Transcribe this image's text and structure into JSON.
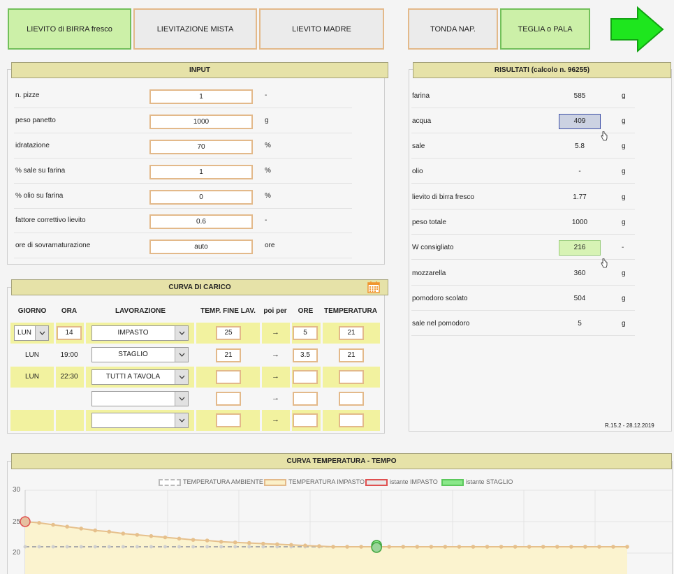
{
  "top_buttons": [
    {
      "label": "LIEVITO di BIRRA fresco"
    },
    {
      "label": "LIEVITAZIONE MISTA"
    },
    {
      "label": "LIEVITO MADRE"
    },
    {
      "label": "TONDA NAP."
    },
    {
      "label": "TEGLIA o PALA"
    }
  ],
  "input": {
    "title": "INPUT",
    "rows": [
      {
        "label": "n. pizze",
        "value": "1",
        "unit": "-"
      },
      {
        "label": "peso panetto",
        "value": "1000",
        "unit": "g"
      },
      {
        "label": "idratazione",
        "value": "70",
        "unit": "%"
      },
      {
        "label": "% sale su farina",
        "value": "1",
        "unit": "%"
      },
      {
        "label": "% olio su farina",
        "value": "0",
        "unit": "%"
      },
      {
        "label": "fattore correttivo lievito",
        "value": "0.6",
        "unit": "-"
      },
      {
        "label": "ore di sovramaturazione",
        "value": "auto",
        "unit": "ore"
      }
    ]
  },
  "results": {
    "title": "RISULTATI (calcolo n. 96255)",
    "rows": [
      {
        "label": "farina",
        "value": "585",
        "unit": "g"
      },
      {
        "label": "acqua",
        "value": "409",
        "unit": "g"
      },
      {
        "label": "sale",
        "value": "5.8",
        "unit": "g"
      },
      {
        "label": "olio",
        "value": "-",
        "unit": "g"
      },
      {
        "label": "lievito di birra fresco",
        "value": "1.77",
        "unit": "g"
      },
      {
        "label": "peso totale",
        "value": "1000",
        "unit": "g"
      },
      {
        "label": "W consigliato",
        "value": "216",
        "unit": "-"
      },
      {
        "label": "mozzarella",
        "value": "360",
        "unit": "g"
      },
      {
        "label": "pomodoro scolato",
        "value": "504",
        "unit": "g"
      },
      {
        "label": "sale nel pomodoro",
        "value": "5",
        "unit": "g"
      }
    ],
    "version": "R.15.2 - 28.12.2019"
  },
  "load_curve": {
    "title": "CURVA DI CARICO",
    "headers": {
      "giorno": "GIORNO",
      "ora": "ORA",
      "lavorazione": "LAVORAZIONE",
      "temp_fine": "TEMP. FINE LAV.",
      "poi_per": "poi per",
      "ore": "ORE",
      "temperatura": "TEMPERATURA"
    },
    "arrow_symbol": "→",
    "rows": [
      {
        "giorno": "LUN",
        "ora": "14",
        "lavorazione": "IMPASTO",
        "temp_fine": "25",
        "ore": "5",
        "temperatura": "21"
      },
      {
        "giorno": "LUN",
        "ora": "19:00",
        "lavorazione": "STAGLIO",
        "temp_fine": "21",
        "ore": "3.5",
        "temperatura": "21"
      },
      {
        "giorno": "LUN",
        "ora": "22:30",
        "lavorazione": "TUTTI A TAVOLA",
        "temp_fine": "",
        "ore": "",
        "temperatura": ""
      },
      {
        "giorno": "",
        "ora": "",
        "lavorazione": "",
        "temp_fine": "",
        "ore": "",
        "temperatura": ""
      },
      {
        "giorno": "",
        "ora": "",
        "lavorazione": "",
        "temp_fine": "",
        "ore": "",
        "temperatura": ""
      }
    ]
  },
  "temp_chart": {
    "title": "CURVA TEMPERATURA - TEMPO",
    "legend": [
      {
        "label": "TEMPERATURA AMBIENTE",
        "color": "#bbbbbb"
      },
      {
        "label": "TEMPERATURA IMPASTO",
        "color": "#e3b98a"
      },
      {
        "label": "istante IMPASTO",
        "color": "#e05050"
      },
      {
        "label": "istante STAGLIO",
        "color": "#5cc85c"
      }
    ],
    "y_ticks": [
      "30",
      "25",
      "20"
    ]
  },
  "chart_data": {
    "type": "line",
    "title": "CURVA TEMPERATURA - TEMPO",
    "ylim": [
      15,
      30
    ],
    "x": [
      0,
      1,
      2,
      3,
      4,
      5,
      6,
      7,
      8,
      9,
      10,
      11,
      12,
      13,
      14,
      15,
      16,
      17,
      18,
      19,
      20,
      21,
      22,
      23,
      24,
      25,
      26,
      27,
      28,
      29,
      30,
      31,
      32,
      33,
      34,
      35,
      36,
      37,
      38,
      39,
      40,
      41,
      42,
      43
    ],
    "series": [
      {
        "name": "TEMPERATURA AMBIENTE",
        "values": [
          21,
          21,
          21,
          21,
          21,
          21,
          21,
          21,
          21,
          21,
          21,
          21,
          21,
          21,
          21,
          21,
          21,
          21,
          21,
          21,
          21,
          21,
          21,
          21,
          21,
          21,
          21,
          21,
          21,
          21,
          21,
          21,
          21,
          21,
          21,
          21,
          21,
          21,
          21,
          21,
          21,
          21,
          21,
          21
        ]
      },
      {
        "name": "TEMPERATURA IMPASTO",
        "values": [
          25,
          24.8,
          24.5,
          24.2,
          23.9,
          23.6,
          23.4,
          23.1,
          22.9,
          22.7,
          22.5,
          22.3,
          22.1,
          22.0,
          21.8,
          21.7,
          21.6,
          21.5,
          21.4,
          21.3,
          21.2,
          21.1,
          21.0,
          21.0,
          21.0,
          21.0,
          21.0,
          21.0,
          21.0,
          21.0,
          21.0,
          21.0,
          21.0,
          21.0,
          21.0,
          21.0,
          21.0,
          21.0,
          21.0,
          21.0,
          21.0,
          21.0,
          21.0,
          21.0
        ]
      },
      {
        "name": "istante IMPASTO",
        "values": [
          25
        ]
      },
      {
        "name": "istante STAGLIO",
        "values": [
          21
        ]
      }
    ],
    "markers": [
      {
        "series": "istante IMPASTO",
        "x": 0,
        "y": 25
      },
      {
        "series": "istante STAGLIO",
        "x": 25,
        "y": 21
      }
    ]
  }
}
